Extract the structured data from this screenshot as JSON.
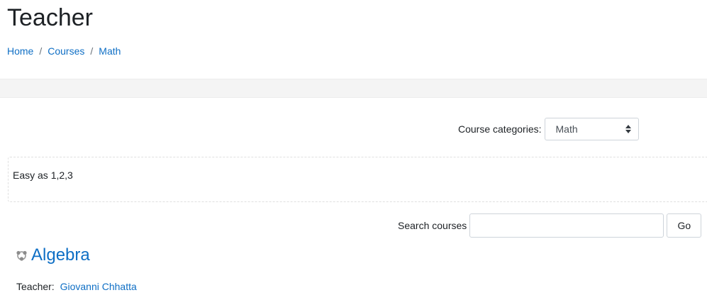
{
  "page": {
    "title": "Teacher"
  },
  "breadcrumb": {
    "items": [
      "Home",
      "Courses",
      "Math"
    ],
    "separator": "/"
  },
  "categories": {
    "label": "Course categories:",
    "selected": "Math"
  },
  "description": {
    "text": "Easy as 1,2,3"
  },
  "search": {
    "label": "Search courses",
    "value": "",
    "button_label": "Go"
  },
  "course": {
    "name": "Algebra",
    "icon": "course-icon",
    "teacher_label": "Teacher:",
    "teacher_name": "Giovanni Chhatta"
  },
  "colors": {
    "link": "#0f6fc5",
    "band": "#f4f4f4"
  }
}
